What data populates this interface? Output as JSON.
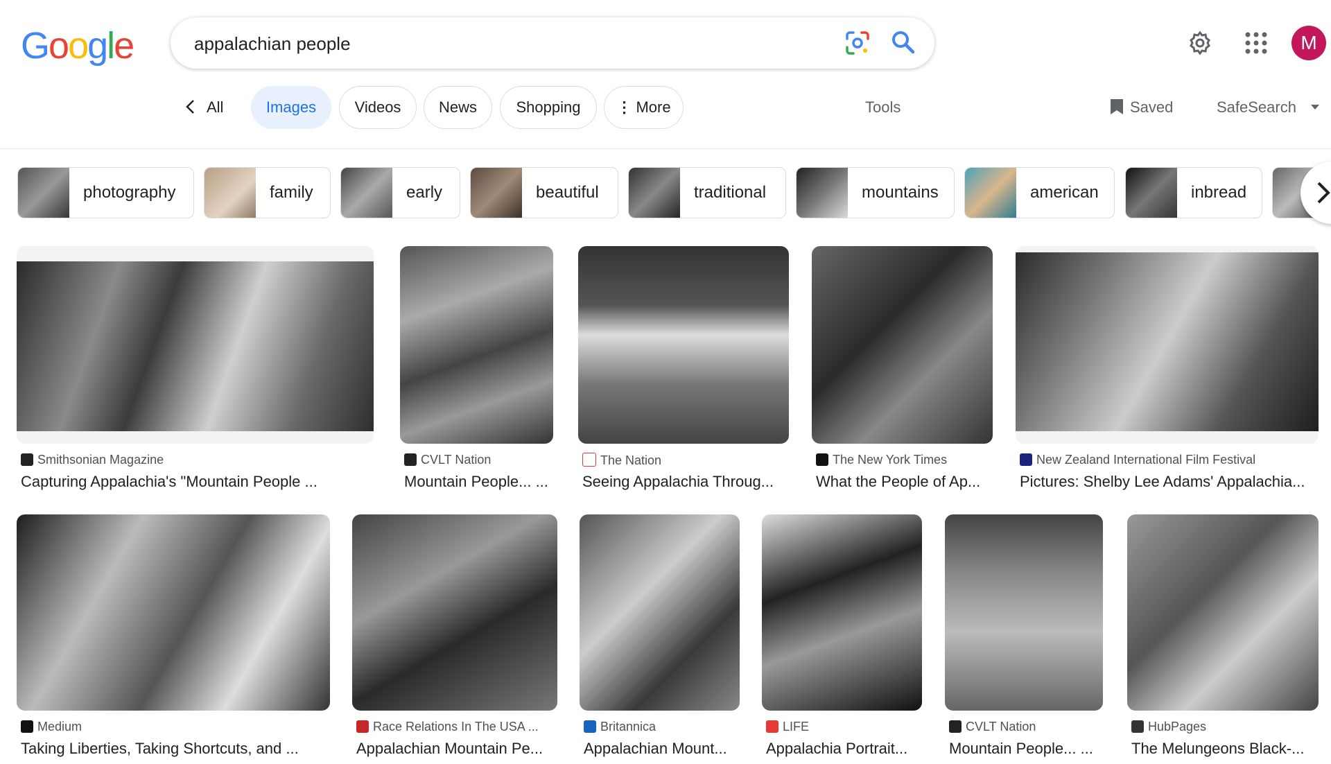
{
  "logo": {
    "letters": [
      "G",
      "o",
      "o",
      "g",
      "l",
      "e"
    ],
    "colors": [
      "#4285f4",
      "#ea4335",
      "#fbbc05",
      "#4285f4",
      "#34a853",
      "#ea4335"
    ]
  },
  "search": {
    "query": "appalachian people"
  },
  "header": {
    "avatar_letter": "M"
  },
  "tabs": {
    "back": "All",
    "items": [
      "Images",
      "Videos",
      "News",
      "Shopping",
      "More"
    ],
    "active": "Images",
    "tools": "Tools",
    "saved": "Saved",
    "safesearch": "SafeSearch"
  },
  "chips": [
    "photography",
    "family",
    "early",
    "beautiful",
    "traditional",
    "mountains",
    "american",
    "inbread"
  ],
  "results_row1": [
    {
      "source": "Smithsonian Magazine",
      "title": "Capturing Appalachia's \"Mountain People ...",
      "favicon_color": "#222"
    },
    {
      "source": "CVLT Nation",
      "title": "Mountain People... ...",
      "favicon_color": "#222"
    },
    {
      "source": "The Nation",
      "title": "Seeing Appalachia Throug...",
      "favicon_color": "#e53935"
    },
    {
      "source": "The New York Times",
      "title": "What the People of Ap...",
      "favicon_color": "#111"
    },
    {
      "source": "New Zealand International Film Festival",
      "title": "Pictures: Shelby Lee Adams' Appalachia...",
      "favicon_color": "#1a237e"
    }
  ],
  "results_row2": [
    {
      "source": "Medium",
      "title": "Taking Liberties, Taking Shortcuts, and ...",
      "favicon_color": "#111"
    },
    {
      "source": "Race Relations In The USA ...",
      "title": "Appalachian Mountain Pe...",
      "favicon_color": "#c62828"
    },
    {
      "source": "Britannica",
      "title": "Appalachian Mount...",
      "favicon_color": "#1565c0"
    },
    {
      "source": "LIFE",
      "title": "Appalachia Portrait...",
      "favicon_color": "#e53935"
    },
    {
      "source": "CVLT Nation",
      "title": "Mountain People... ...",
      "favicon_color": "#222"
    },
    {
      "source": "HubPages",
      "title": "The Melungeons Black-...",
      "favicon_color": "#333"
    }
  ]
}
